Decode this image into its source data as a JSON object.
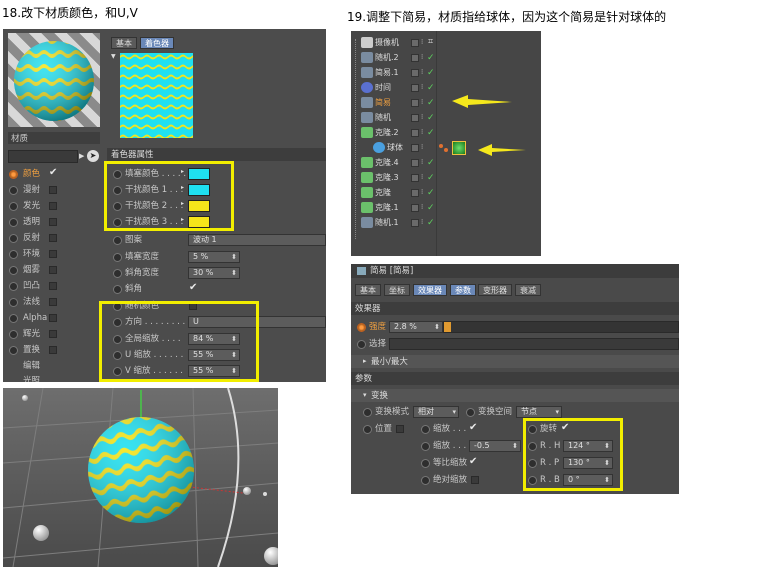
{
  "captions": {
    "left": "18.改下材质颜色，和U,V",
    "right": "19.调整下简易，材质指给球体，因为这个简易是针对球体的"
  },
  "colors": {
    "cyan": "#1fe0f0",
    "yellow": "#f5e51a",
    "highlight": "#f2ee00",
    "arrow": "#f5e81c"
  },
  "material": {
    "name": "材质",
    "tabs": [
      "基本",
      "着色器"
    ],
    "active_tab": "着色器",
    "channels": [
      {
        "label": "颜色",
        "checked": true,
        "active": true
      },
      {
        "label": "漫射",
        "checked": false
      },
      {
        "label": "发光",
        "checked": false
      },
      {
        "label": "透明",
        "checked": false
      },
      {
        "label": "反射",
        "checked": false
      },
      {
        "label": "环境",
        "checked": false
      },
      {
        "label": "烟雾",
        "checked": false
      },
      {
        "label": "凹凸",
        "checked": false
      },
      {
        "label": "法线",
        "checked": false
      },
      {
        "label": "Alpha",
        "checked": false
      },
      {
        "label": "辉光",
        "checked": false
      },
      {
        "label": "置换",
        "checked": false
      }
    ],
    "extra_items": [
      "编辑",
      "光照"
    ],
    "shader_props_title": "着色器属性",
    "colors": [
      {
        "label": "填塞颜色 . . . . .",
        "color": "#1fe0f0"
      },
      {
        "label": "干扰颜色 1 . . .",
        "color": "#1fe0f0"
      },
      {
        "label": "干扰颜色 2 . . .",
        "color": "#f5e51a"
      },
      {
        "label": "干扰颜色 3 . . .",
        "color": "#f5e51a"
      }
    ],
    "params": [
      {
        "label": "图案",
        "value": "波动 1"
      },
      {
        "label": "填塞宽度",
        "value": "5 %"
      },
      {
        "label": "斜角宽度",
        "value": "30 %"
      },
      {
        "label": "斜角",
        "value": "✔"
      },
      {
        "label": "随机颜色",
        "value": ""
      },
      {
        "label": "方向 . . . . . . . .",
        "value": "U"
      },
      {
        "label": "全局缩放 . . . .",
        "value": "84 %"
      },
      {
        "label": "U 缩放 . . . . . .",
        "value": "55 %"
      },
      {
        "label": "V 缩放 . . . . . .",
        "value": "55 %"
      }
    ]
  },
  "outliner": {
    "items": [
      {
        "label": "摄像机",
        "icon": "camera-icon",
        "selected": false
      },
      {
        "label": "随机.2",
        "icon": "effector-icon",
        "selected": false
      },
      {
        "label": "简易.1",
        "icon": "effector-icon",
        "selected": false
      },
      {
        "label": "时间",
        "icon": "time-icon",
        "selected": false
      },
      {
        "label": "简易",
        "icon": "effector-icon",
        "selected": true
      },
      {
        "label": "随机",
        "icon": "effector-icon",
        "selected": false
      },
      {
        "label": "克隆.2",
        "icon": "cloner-icon",
        "selected": false
      },
      {
        "label": "球体",
        "icon": "sphere-icon",
        "selected": false
      },
      {
        "label": "克隆.4",
        "icon": "cloner-icon",
        "selected": false
      },
      {
        "label": "克隆.3",
        "icon": "cloner-icon",
        "selected": false
      },
      {
        "label": "克隆",
        "icon": "cloner-icon",
        "selected": false
      },
      {
        "label": "克隆.1",
        "icon": "cloner-icon",
        "selected": false
      },
      {
        "label": "随机.1",
        "icon": "effector-icon",
        "selected": false
      }
    ]
  },
  "effector": {
    "title": "简易 [简易]",
    "tabs": [
      "基本",
      "坐标",
      "效果器",
      "参数",
      "变形器",
      "衰减"
    ],
    "active_tabs": [
      "效果器",
      "参数"
    ],
    "section_effector": "效果器",
    "strength": {
      "label": "强度",
      "value": "2.8 %",
      "fill": 0.028
    },
    "select_label": "选择",
    "minmax_label": "最小/最大",
    "section_params": "参数",
    "transform_label": "变换",
    "transform_mode_label": "变换模式",
    "transform_mode_value": "相对",
    "transform_space_label": "变换空间",
    "transform_space_value": "节点",
    "position_label": "位置",
    "scale_label": "缩放 . . .",
    "scale_amount_label": "缩放 . . .",
    "scale_amount_value": "-0.5",
    "uniform_scale_label": "等比缩放",
    "absolute_scale_label": "绝对缩放",
    "rotation_label": "旋转",
    "rot_h": {
      "label": "R . H",
      "value": "124 °"
    },
    "rot_p": {
      "label": "R . P",
      "value": "130 °"
    },
    "rot_b": {
      "label": "R . B",
      "value": "0 °"
    }
  }
}
